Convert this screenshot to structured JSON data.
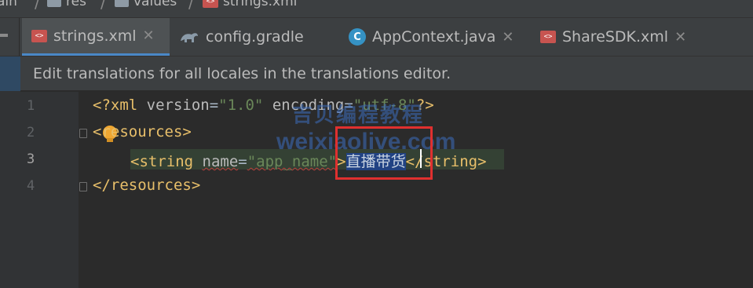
{
  "breadcrumb": {
    "items": [
      {
        "label": "main",
        "icon": "folder-icon"
      },
      {
        "label": "res",
        "icon": "folder-icon"
      },
      {
        "label": "values",
        "icon": "folder-icon"
      },
      {
        "label": "strings.xml",
        "icon": "xml-file-icon"
      }
    ],
    "visible_labels": [
      "ain",
      "res",
      "values",
      "strings.xml"
    ]
  },
  "tabs": [
    {
      "label": "strings.xml",
      "icon": "xml-file-icon",
      "active": true
    },
    {
      "label": "config.gradle",
      "icon": "gradle-icon",
      "active": false
    },
    {
      "label": "AppContext.java",
      "icon": "class-c-icon",
      "active": false
    },
    {
      "label": "ShareSDK.xml",
      "icon": "xml-file-icon",
      "active": false
    }
  ],
  "close_glyph": "✕",
  "xml_icon_text": "<>",
  "class_icon_text": "C",
  "banner": {
    "text": "Edit translations for all locales in the translations editor."
  },
  "editor": {
    "line_numbers": [
      "1",
      "2",
      "3",
      "4"
    ],
    "line1": {
      "open": "<?xml ",
      "attr1": "version",
      "eq1": "=",
      "val1": "\"1.0\"",
      "attr2": " encoding",
      "eq2": "=",
      "val2": "\"utf-8\"",
      "close": "?>"
    },
    "line2": {
      "open": "<",
      "tag": "resources",
      "close": ">"
    },
    "line3": {
      "open": "<string ",
      "attr": "name",
      "eq": "=",
      "val": "\"app_name\"",
      "gt": ">",
      "text": "直播带货",
      "close": "</string>"
    },
    "line4": {
      "text": "</resources>"
    },
    "selected_text": "直播带货"
  },
  "watermark": {
    "line1": "吉贝编程教程",
    "line2": "weixiaolive.com"
  },
  "colors": {
    "background": "#2b2b2b",
    "tag": "#e8bf6a",
    "attribute": "#bababa",
    "value": "#6a8759",
    "selection": "#214283",
    "highlight_box": "#e0302f",
    "active_tab_underline": "#4a88c7"
  }
}
